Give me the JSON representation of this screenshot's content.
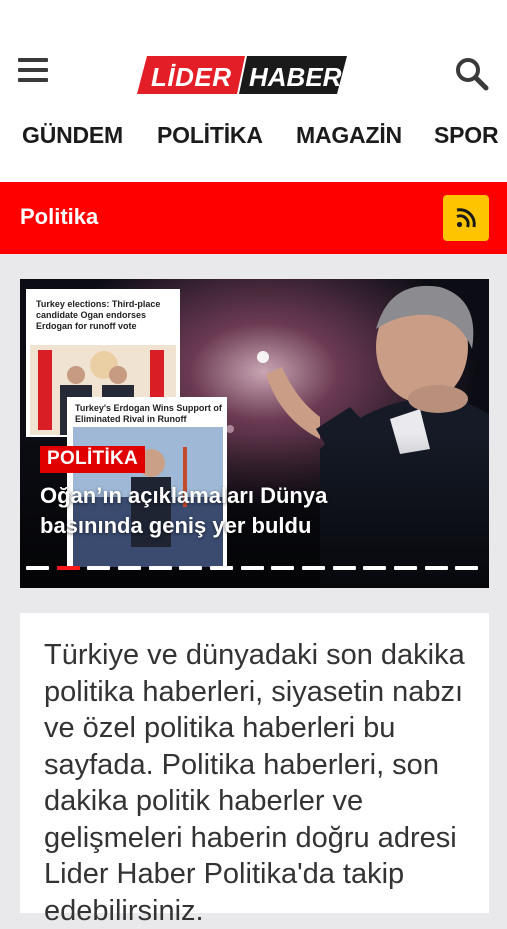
{
  "header": {
    "logo_left": "LİDER",
    "logo_right": "HABER",
    "menu_icon": "hamburger-menu-icon",
    "search_icon": "search-icon",
    "brand_red": "#e41e26",
    "brand_black": "#1a1a1a"
  },
  "nav": {
    "tabs": [
      {
        "label": "GÜNDEM"
      },
      {
        "label": "POLİTİKA"
      },
      {
        "label": "MAGAZİN"
      },
      {
        "label": "SPOR"
      }
    ]
  },
  "section": {
    "title": "Politika",
    "rss_icon": "rss-icon",
    "bar_color": "#ff0000",
    "rss_color": "#ffc400"
  },
  "slider": {
    "card1_text": "Turkey elections: Third-place candidate Ogan endorses Erdogan for runoff vote",
    "card2_text": "Turkey's Erdogan Wins Support of Eliminated Rival in Runoff",
    "category": "POLİTİKA",
    "headline": "Oğan’ın açıklamaları Dünya basınında geniş yer buldu",
    "slide_count": 15,
    "active_slide": 2
  },
  "description": {
    "text": "Türkiye ve dünyadaki son dakika politika haberleri, siyasetin nabzı ve özel politika haberleri bu sayfada. Politika haberleri, son dakika politik haberler ve gelişmeleri haberin doğru adresi Lider Haber Politika'da takip edebilirsiniz."
  }
}
